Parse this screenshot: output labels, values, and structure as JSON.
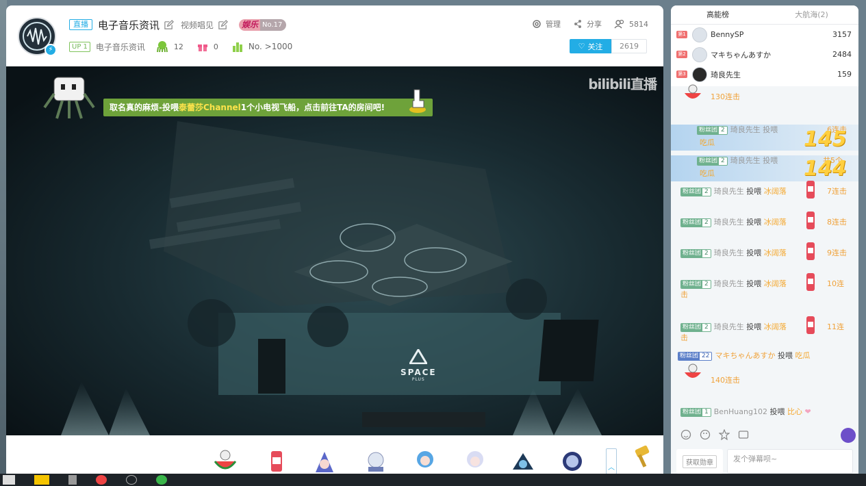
{
  "header": {
    "live_tag": "直播",
    "title": "电子音乐资讯",
    "sub_label": "视频唱见",
    "area_tag": "娱乐",
    "area_rank": "No.17",
    "up_tag": "UP 1",
    "up_name": "电子音乐资讯",
    "fans_count": "12",
    "gift_count": "0",
    "rank_text": "No. >1000",
    "manage": "管理",
    "share": "分享",
    "viewers": "5814",
    "follow_label": "关注",
    "follow_count": "2619"
  },
  "player": {
    "watermark": "bilibili直播",
    "notice_pre": "取名真的麻烦-投喂",
    "notice_hl": "泰蕾莎Channel",
    "notice_post": "1个小电视飞船，点击前往TA的房间吧!",
    "logo_line1": "SPACE",
    "logo_line2": "PLUS"
  },
  "side": {
    "tabs": [
      "高能榜",
      "大航海(2)"
    ],
    "rank": [
      {
        "badge": "第1",
        "name": "BennySP",
        "score": "3157"
      },
      {
        "badge": "第2",
        "name": "マキちゃんあすか",
        "score": "2484"
      },
      {
        "badge": "第3",
        "name": "琦良先生",
        "score": "159"
      }
    ],
    "chat": {
      "top_combo": "130连击",
      "overlay1": {
        "fan": "粉丝团",
        "lvl": "2",
        "user": "琦良先生",
        "action": "投喂",
        "gift": "吃瓜",
        "combo": "6连击",
        "big": "145"
      },
      "overlay2": {
        "fan": "粉丝团",
        "lvl": "2",
        "user": "琦良先生",
        "action": "投喂",
        "gift": "吃瓜",
        "combo": "共5个",
        "big": "144"
      },
      "rows": [
        {
          "fan": "粉丝团",
          "lvl": "2",
          "user": "琦良先生",
          "action": "投喂",
          "gift": "冰阔落",
          "combo": "7连击"
        },
        {
          "fan": "粉丝团",
          "lvl": "2",
          "user": "琦良先生",
          "action": "投喂",
          "gift": "冰阔落",
          "combo": "8连击"
        },
        {
          "fan": "粉丝团",
          "lvl": "2",
          "user": "琦良先生",
          "action": "投喂",
          "gift": "冰阔落",
          "combo": "9连击"
        },
        {
          "fan": "粉丝团",
          "lvl": "2",
          "user": "琦良先生",
          "action": "投喂",
          "gift": "冰阔落",
          "combo": "10连",
          "combo2": "击"
        },
        {
          "fan": "粉丝团",
          "lvl": "2",
          "user": "琦良先生",
          "action": "投喂",
          "gift": "冰阔落",
          "combo": "11连",
          "combo2": "击"
        }
      ],
      "maki": {
        "fan": "粉丝团",
        "lvl": "22",
        "user": "マキちゃんあすか",
        "action": "投喂",
        "gift": "吃瓜",
        "combo": "140连击"
      },
      "benny": {
        "fan": "粉丝团",
        "lvl": "1",
        "user": "BenHuang102",
        "action": "投喂",
        "gift": "比心"
      }
    },
    "medal": "获取勋章",
    "placeholder": "发个弹幕呗~"
  },
  "colors": {
    "accent": "#23ade5",
    "fan_green": "#6fb18e",
    "gift_orange": "#f4a72c",
    "notice_green": "#6ea23a"
  }
}
